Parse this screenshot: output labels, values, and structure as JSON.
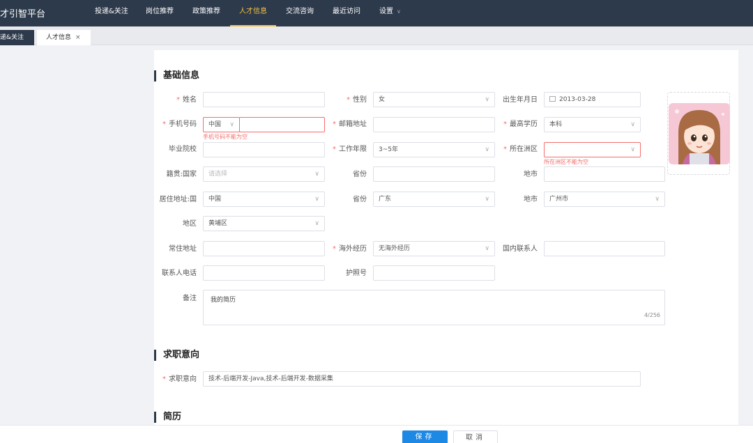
{
  "brand": "才引智平台",
  "nav": {
    "items": [
      "投递&关注",
      "岗位推荐",
      "政策推荐",
      "人才信息",
      "交流咨询",
      "最近访问",
      "设置"
    ],
    "active_index": 3
  },
  "tabs": [
    {
      "label": "递&关注"
    },
    {
      "label": "人才信息",
      "close": "×"
    }
  ],
  "sections": {
    "basic": "基础信息",
    "intent": "求职意向",
    "resume": "简历"
  },
  "form": {
    "name": {
      "label": "姓名",
      "value": ""
    },
    "gender": {
      "label": "性别",
      "value": "女"
    },
    "birth": {
      "label": "出生年月日",
      "value": "2013-03-28"
    },
    "phone": {
      "label": "手机号码",
      "country": "中国",
      "value": "",
      "error": "手机号码不能为空"
    },
    "email": {
      "label": "邮箱地址",
      "value": ""
    },
    "education": {
      "label": "最高学历",
      "value": "本科"
    },
    "school": {
      "label": "毕业院校",
      "value": ""
    },
    "work_years": {
      "label": "工作年限",
      "value": "3~5年"
    },
    "continent": {
      "label": "所在洲区",
      "value": "",
      "error": "所在洲区不能为空"
    },
    "native_country": {
      "label": "籍贯:国家",
      "placeholder": "请选择"
    },
    "native_province": {
      "label": "省份",
      "value": ""
    },
    "native_city": {
      "label": "地市",
      "value": ""
    },
    "res_country": {
      "label": "居住地址:国",
      "value": "中国"
    },
    "res_province": {
      "label": "省份",
      "value": "广东"
    },
    "res_city": {
      "label": "地市",
      "value": "广州市"
    },
    "res_district": {
      "label": "地区",
      "value": "黄埔区"
    },
    "address": {
      "label": "常住地址",
      "value": ""
    },
    "overseas": {
      "label": "海外经历",
      "value": "无海外经历"
    },
    "domestic_contact": {
      "label": "国内联系人",
      "value": ""
    },
    "contact_phone": {
      "label": "联系人电话",
      "value": ""
    },
    "passport": {
      "label": "护照号",
      "value": ""
    },
    "remark": {
      "label": "备注",
      "value": "我的简历",
      "counter": "4/256"
    },
    "job_intent": {
      "label": "求职意向",
      "value": "技术-后端开发-Java,技术-后端开发-数据采集"
    }
  },
  "buttons": {
    "save": "保存",
    "cancel": "取消"
  },
  "colors": {
    "nav_bg": "#2d3a4b",
    "accent": "#f5c043",
    "primary": "#1e88e5",
    "error": "#f56c6c"
  }
}
